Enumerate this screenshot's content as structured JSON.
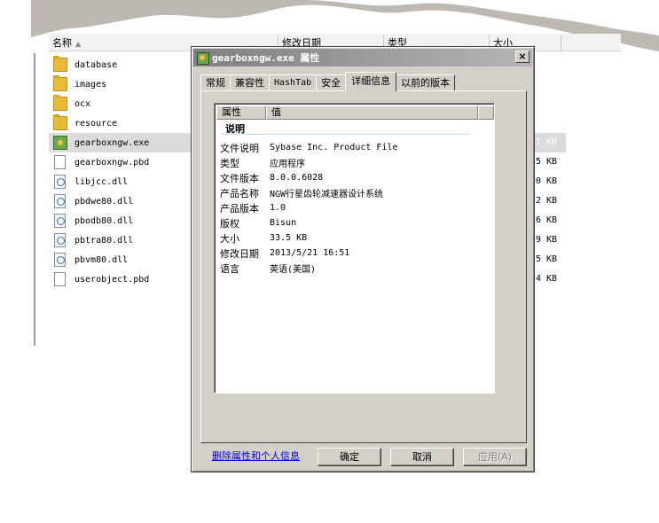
{
  "explorer": {
    "columns": {
      "name": "名称",
      "modified": "修改日期",
      "type": "类型",
      "size": "大小"
    },
    "files": [
      {
        "name": "database",
        "icon": "folder-icon",
        "size": ""
      },
      {
        "name": "images",
        "icon": "folder-icon",
        "size": ""
      },
      {
        "name": "ocx",
        "icon": "folder-icon",
        "size": ""
      },
      {
        "name": "resource",
        "icon": "folder-icon",
        "size": ""
      },
      {
        "name": "gearboxngw.exe",
        "icon": "exe-icon",
        "size": "1 KB",
        "selected": true
      },
      {
        "name": "gearboxngw.pbd",
        "icon": "document-icon",
        "size": "5 KB"
      },
      {
        "name": "libjcc.dll",
        "icon": "dll-icon",
        "size": "0 KB"
      },
      {
        "name": "pbdwe80.dll",
        "icon": "dll-icon",
        "size": "2 KB"
      },
      {
        "name": "pbodb80.dll",
        "icon": "dll-icon",
        "size": "6 KB"
      },
      {
        "name": "pbtra80.dll",
        "icon": "dll-icon",
        "size": "9 KB"
      },
      {
        "name": "pbvm80.dll",
        "icon": "dll-icon",
        "size": "5 KB"
      },
      {
        "name": "userobject.pbd",
        "icon": "document-icon",
        "size": "4 KB"
      }
    ]
  },
  "dialog": {
    "title": "gearboxngw.exe 属性",
    "close_label": "×",
    "tabs": [
      "常规",
      "兼容性",
      "HashTab",
      "安全",
      "详细信息",
      "以前的版本"
    ],
    "active_tab": "详细信息",
    "list_header": {
      "property": "属性",
      "value": "值"
    },
    "group_title": "说明",
    "rows": [
      {
        "key": "文件说明",
        "value": "Sybase Inc. Product File"
      },
      {
        "key": "类型",
        "value": "应用程序"
      },
      {
        "key": "文件版本",
        "value": "8.0.0.6028"
      },
      {
        "key": "产品名称",
        "value": "NGW行星齿轮减速器设计系统"
      },
      {
        "key": "产品版本",
        "value": "1.0"
      },
      {
        "key": "版权",
        "value": "Bisun"
      },
      {
        "key": "大小",
        "value": "33.5 KB"
      },
      {
        "key": "修改日期",
        "value": "2013/5/21 16:51"
      },
      {
        "key": "语言",
        "value": "英语(美国)"
      }
    ],
    "remove_link": "删除属性和个人信息",
    "buttons": {
      "ok": "确定",
      "cancel": "取消",
      "apply": "应用(A)"
    }
  }
}
